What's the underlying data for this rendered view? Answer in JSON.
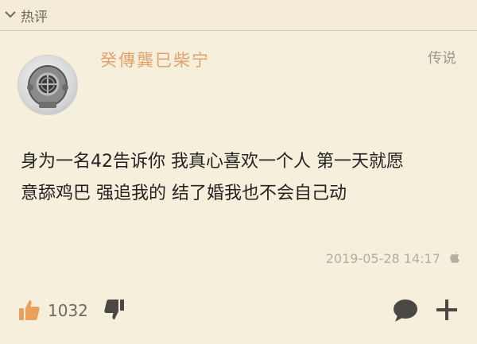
{
  "section": {
    "title": "热评",
    "icon": "chevron-down-icon"
  },
  "comment": {
    "username": "癸傳龔巳柴宁",
    "badge": "传说",
    "lines": [
      "身为一名42告诉你 我真心喜欢一个人 第一天就愿",
      "意舔鸡巴 强追我的 结了婚我也不会自己动"
    ],
    "timestamp": "2019-05-28 14:17",
    "platform_icon": "apple-icon",
    "like_count": "1032"
  },
  "colors": {
    "background": "#f6efdb",
    "username": "#e2a16d",
    "like_icon": "#e8a05c",
    "muted": "#9c9891",
    "text": "#222222"
  }
}
